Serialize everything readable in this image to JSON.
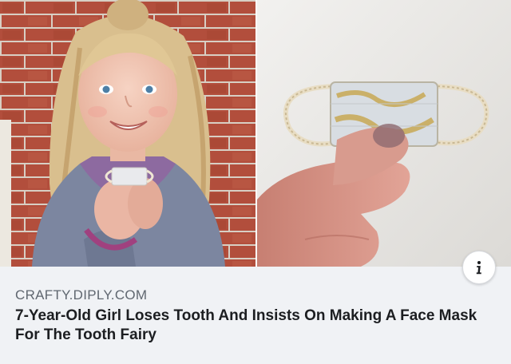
{
  "link_preview": {
    "domain": "CRAFTY.DIPLY.COM",
    "headline": "7-Year-Old Girl Loses Tooth And Insists On Making A Face Mask For The Tooth Fairy"
  },
  "images": [
    {
      "name": "girl-holding-tiny-mask-photo"
    },
    {
      "name": "hand-holding-tiny-mask-photo"
    }
  ],
  "icons": {
    "info": "info-icon"
  }
}
